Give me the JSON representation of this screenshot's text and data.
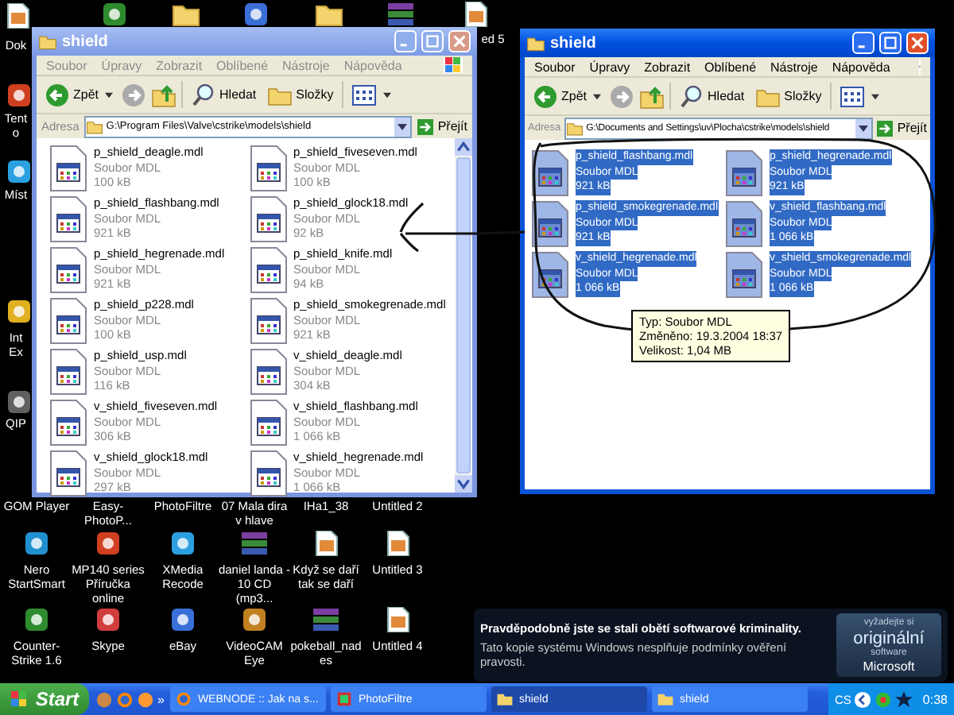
{
  "desktop_icons": [
    {
      "kind": "file",
      "label": "Dok"
    },
    {
      "kind": "app"
    },
    {
      "kind": "folder"
    },
    {
      "kind": "app"
    },
    {
      "kind": "folder"
    },
    {
      "kind": "archive"
    },
    {
      "kind": "file",
      "label": "ed 5"
    },
    {
      "kind": "app",
      "label": "Tento"
    },
    {
      "kind": "app",
      "label": "Míst"
    },
    {
      "kind": "app",
      "label": "Int Ex"
    },
    {
      "kind": "app",
      "label": "QIP"
    },
    {
      "label": "GOM Player"
    },
    {
      "label": "Easy-PhotoP..."
    },
    {
      "label": "PhotoFiltre"
    },
    {
      "label": "07 Mala dira v hlave"
    },
    {
      "label": "IHa1_38"
    },
    {
      "label": "Untitled 2"
    },
    {
      "kind": "app",
      "label": "Nero StartSmart"
    },
    {
      "kind": "app",
      "label": "MP140 series Příručka online"
    },
    {
      "kind": "app",
      "label": "XMedia Recode"
    },
    {
      "kind": "archive",
      "label": "daniel landa - 10 CD (mp3..."
    },
    {
      "kind": "file",
      "label": "Když se daří tak se daří"
    },
    {
      "kind": "file",
      "label": "Untitled 3"
    },
    {
      "kind": "app",
      "label": "Counter-Strike 1.6"
    },
    {
      "kind": "app",
      "label": "Skype"
    },
    {
      "kind": "app",
      "label": "eBay"
    },
    {
      "kind": "app",
      "label": "VideoCAM Eye"
    },
    {
      "kind": "archive",
      "label": "pokeball_nades"
    },
    {
      "kind": "file",
      "label": "Untitled 4"
    }
  ],
  "windows": [
    {
      "title": "shield",
      "active": false,
      "menu": [
        "Soubor",
        "Úpravy",
        "Zobrazit",
        "Oblíbené",
        "Nástroje",
        "Nápověda"
      ],
      "back": "Zpět",
      "search": "Hledat",
      "folders": "Složky",
      "address_label": "Adresa",
      "address": "G:\\Program Files\\Valve\\cstrike\\models\\shield",
      "go": "Přejít",
      "scrollbar": true,
      "files": [
        {
          "name": "p_shield_deagle.mdl",
          "type": "Soubor MDL",
          "size": "100 kB",
          "selected": false
        },
        {
          "name": "p_shield_fiveseven.mdl",
          "type": "Soubor MDL",
          "size": "100 kB",
          "selected": false
        },
        {
          "name": "p_shield_flashbang.mdl",
          "type": "Soubor MDL",
          "size": "921 kB",
          "selected": false
        },
        {
          "name": "p_shield_glock18.mdl",
          "type": "Soubor MDL",
          "size": "92 kB",
          "selected": false
        },
        {
          "name": "p_shield_hegrenade.mdl",
          "type": "Soubor MDL",
          "size": "921 kB",
          "selected": false
        },
        {
          "name": "p_shield_knife.mdl",
          "type": "Soubor MDL",
          "size": "94 kB",
          "selected": false
        },
        {
          "name": "p_shield_p228.mdl",
          "type": "Soubor MDL",
          "size": "100 kB",
          "selected": false
        },
        {
          "name": "p_shield_smokegrenade.mdl",
          "type": "Soubor MDL",
          "size": "921 kB",
          "selected": false
        },
        {
          "name": "p_shield_usp.mdl",
          "type": "Soubor MDL",
          "size": "116 kB",
          "selected": false
        },
        {
          "name": "v_shield_deagle.mdl",
          "type": "Soubor MDL",
          "size": "304 kB",
          "selected": false
        },
        {
          "name": "v_shield_fiveseven.mdl",
          "type": "Soubor MDL",
          "size": "306 kB",
          "selected": false
        },
        {
          "name": "v_shield_flashbang.mdl",
          "type": "Soubor MDL",
          "size": "1 066 kB",
          "selected": false
        },
        {
          "name": "v_shield_glock18.mdl",
          "type": "Soubor MDL",
          "size": "297 kB",
          "selected": false
        },
        {
          "name": "v_shield_hegrenade.mdl",
          "type": "Soubor MDL",
          "size": "1 066 kB",
          "selected": false
        }
      ]
    },
    {
      "title": "shield",
      "active": true,
      "menu": [
        "Soubor",
        "Úpravy",
        "Zobrazit",
        "Oblíbené",
        "Nástroje",
        "Nápověda"
      ],
      "back": "Zpět",
      "search": "Hledat",
      "folders": "Složky",
      "address_label": "Adresa",
      "address": "G:\\Documents and Settings\\uv\\Plocha\\cstrike\\models\\shield",
      "go": "Přejít",
      "scrollbar": false,
      "files": [
        {
          "name": "p_shield_flashbang.mdl",
          "type": "Soubor MDL",
          "size": "921 kB",
          "selected": true
        },
        {
          "name": "p_shield_hegrenade.mdl",
          "type": "Soubor MDL",
          "size": "921 kB",
          "selected": true
        },
        {
          "name": "p_shield_smokegrenade.mdl",
          "type": "Soubor MDL",
          "size": "921 kB",
          "selected": true
        },
        {
          "name": "v_shield_flashbang.mdl",
          "type": "Soubor MDL",
          "size": "1 066 kB",
          "selected": true
        },
        {
          "name": "v_shield_hegrenade.mdl",
          "type": "Soubor MDL",
          "size": "1 066 kB",
          "selected": true
        },
        {
          "name": "v_shield_smokegrenade.mdl",
          "type": "Soubor MDL",
          "size": "1 066 kB",
          "selected": true
        }
      ]
    }
  ],
  "tooltip": [
    "Typ: Soubor MDL",
    "Změněno: 19.3.2004 18:37",
    "Velikost: 1,04 MB"
  ],
  "notification": {
    "title": "Pravděpodobně jste se stali obětí softwarové kriminality.",
    "text": "Tato kopie systému Windows nesplňuje podmínky ověření pravosti.",
    "logo": [
      "vyžadejte si",
      "originální",
      "software",
      "Microsoft"
    ]
  },
  "taskbar": {
    "start": "Start",
    "overflow": "»",
    "buttons": [
      {
        "kind": "browser",
        "label": "WEBNODE :: Jak na s...",
        "selected": false
      },
      {
        "kind": "photo",
        "label": "PhotoFiltre",
        "selected": false
      },
      {
        "kind": "folder",
        "label": "shield",
        "selected": true
      },
      {
        "kind": "folder",
        "label": "shield",
        "selected": false
      }
    ],
    "language": "CS",
    "time": "0:38"
  }
}
